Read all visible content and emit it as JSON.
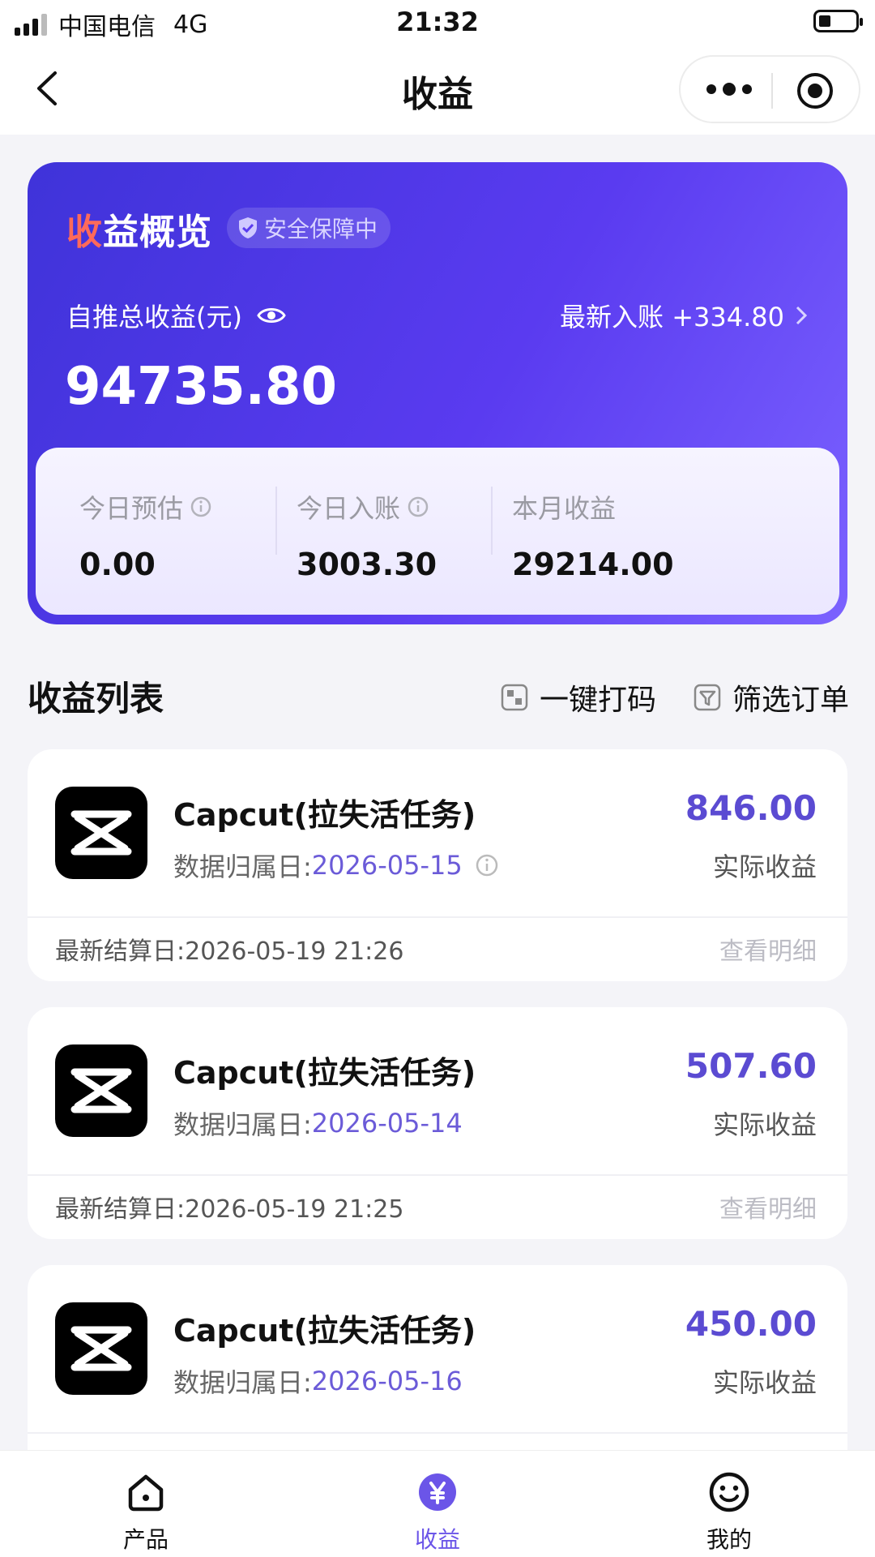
{
  "status_bar": {
    "carrier": "中国电信",
    "network": "4G",
    "time": "21:32"
  },
  "nav": {
    "title": "收益"
  },
  "overview": {
    "title_first": "收",
    "title_rest": "益概览",
    "badge": "安全保障中",
    "total_label": "自推总收益(元)",
    "latest_label": "最新入账 +334.80",
    "total_amount": "94735.80",
    "stats": [
      {
        "label": "今日预估",
        "value": "0.00"
      },
      {
        "label": "今日入账",
        "value": "3003.30"
      },
      {
        "label": "本月收益",
        "value": "29214.00"
      }
    ]
  },
  "list": {
    "title": "收益列表",
    "action_code": "一键打码",
    "action_filter": "筛选订单",
    "items": [
      {
        "name": "Capcut(拉失活任务)",
        "date_label": "数据归属日: ",
        "date": "2026-05-15",
        "amount": "846.00",
        "amount_label": "实际收益",
        "settle": "最新结算日:2026-05-19 21:26",
        "detail": "查看明细"
      },
      {
        "name": "Capcut(拉失活任务)",
        "date_label": "数据归属日: ",
        "date": "2026-05-14",
        "amount": "507.60",
        "amount_label": "实际收益",
        "settle": "最新结算日:2026-05-19 21:25",
        "detail": "查看明细"
      },
      {
        "name": "Capcut(拉失活任务)",
        "date_label": "数据归属日: ",
        "date": "2026-05-16",
        "amount": "450.00",
        "amount_label": "实际收益",
        "settle": "",
        "detail": ""
      }
    ]
  },
  "tabbar": {
    "items": [
      {
        "label": "产品",
        "icon": "home-icon"
      },
      {
        "label": "收益",
        "icon": "yen-icon"
      },
      {
        "label": "我的",
        "icon": "smile-icon"
      }
    ]
  },
  "colors": {
    "accent": "#5b4bd2",
    "hero_start": "#3f33d9",
    "hero_end": "#7b62ff",
    "tab_active": "#6b55e8"
  }
}
